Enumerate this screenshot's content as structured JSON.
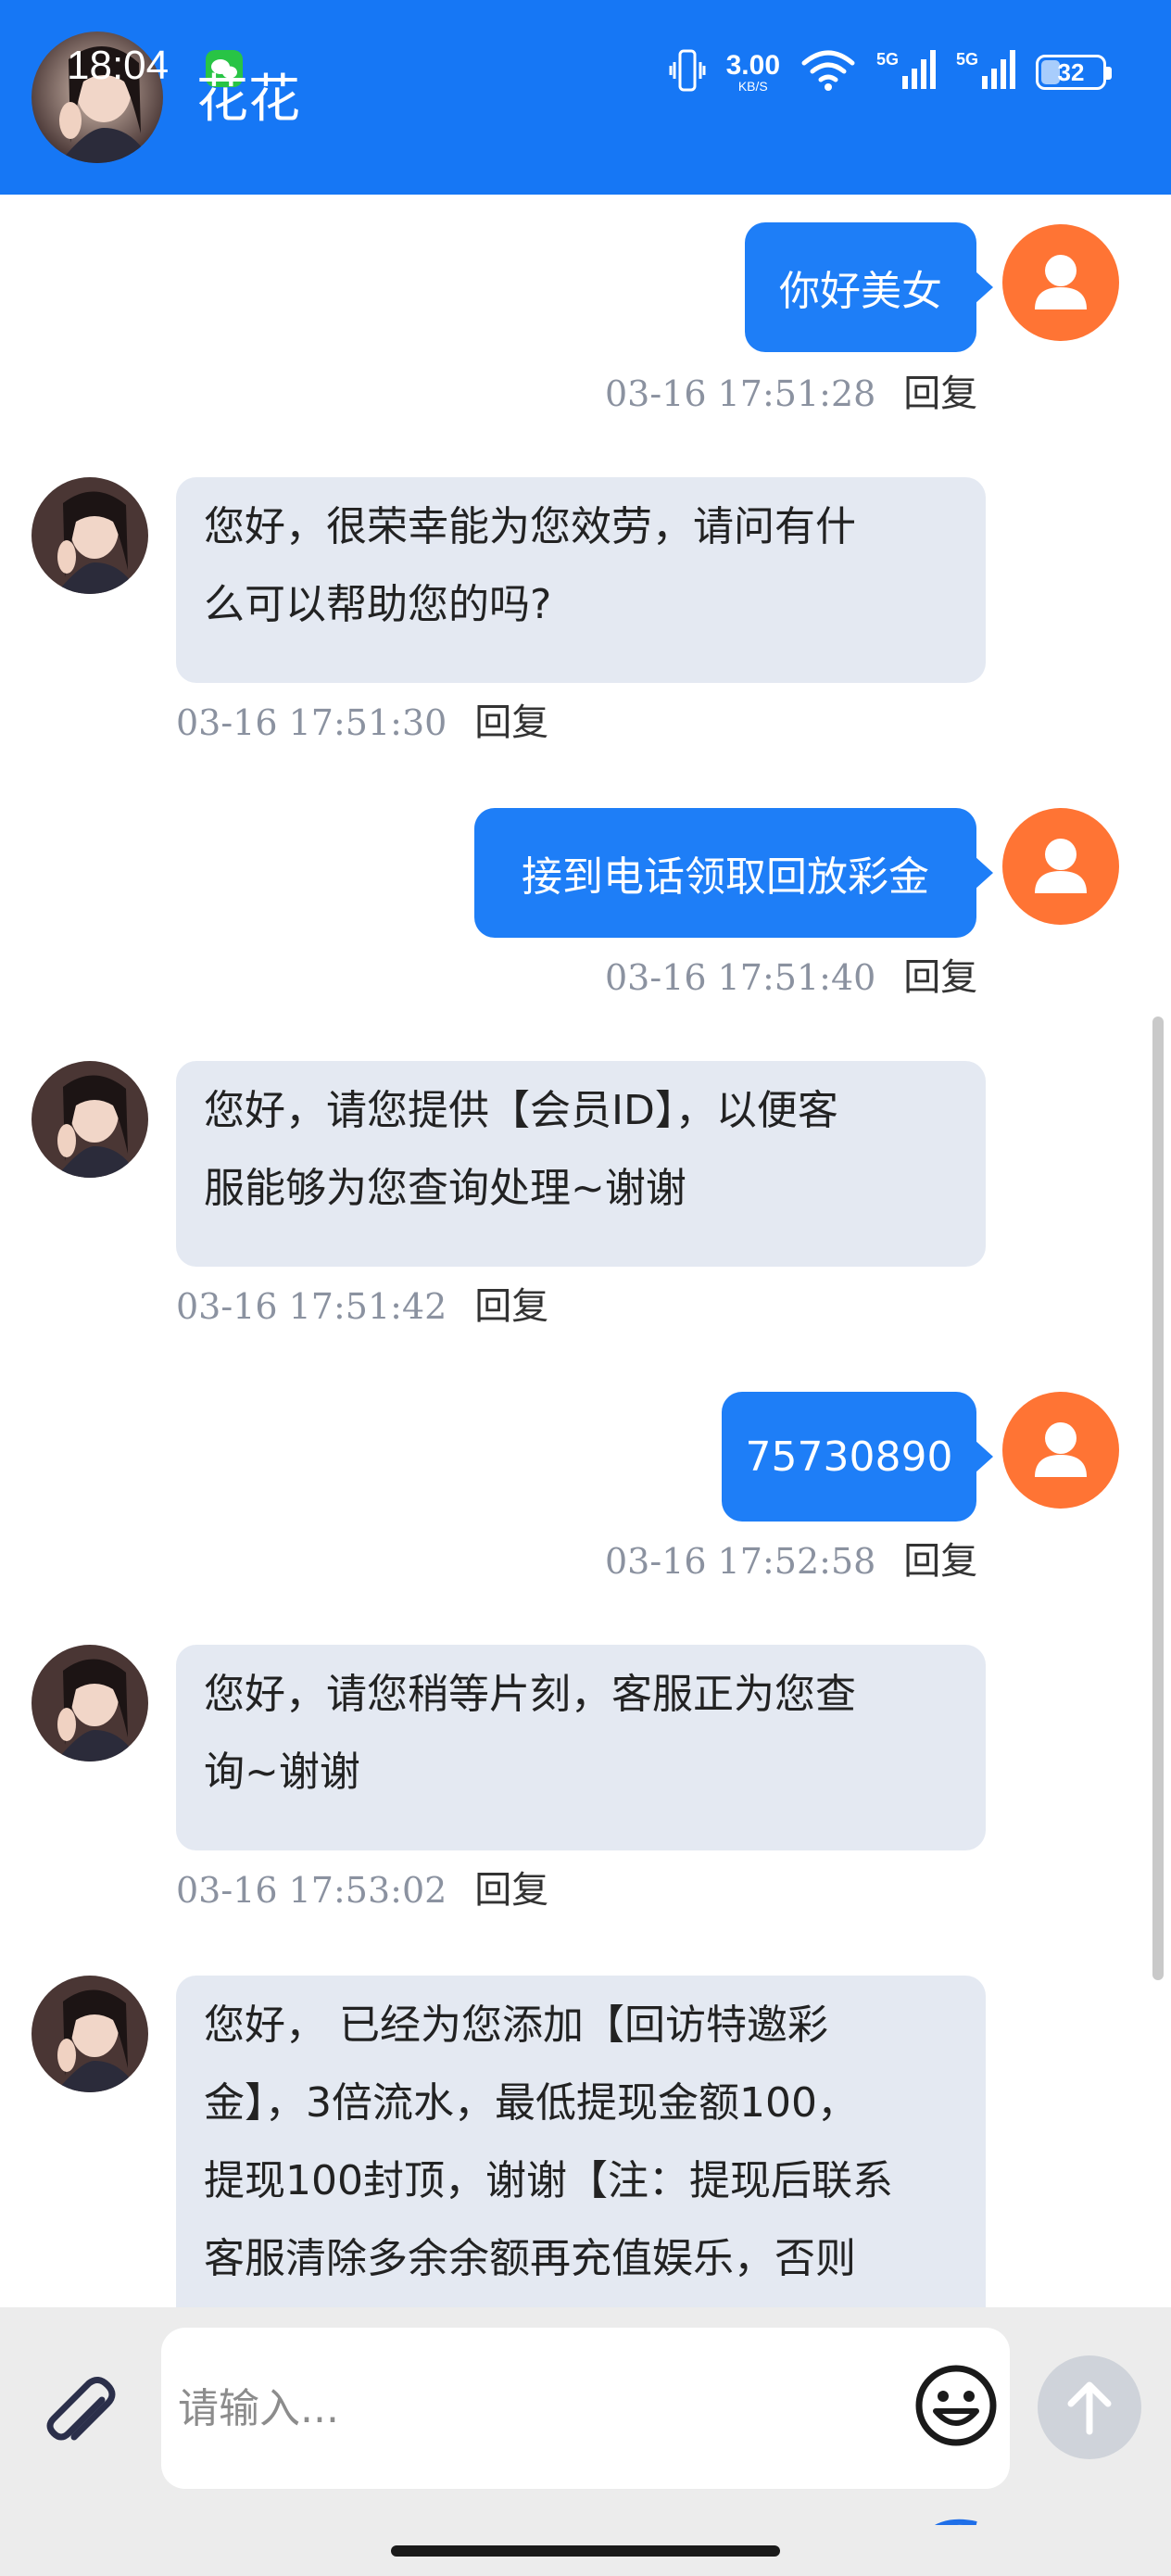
{
  "status_bar": {
    "time": "18:04",
    "net_speed_value": "3.00",
    "net_speed_unit": "KB/S",
    "signal_1": "5G",
    "signal_2": "5G",
    "battery_level": "32",
    "battery_fraction": 0.32
  },
  "header": {
    "contact_name": "花花"
  },
  "messages": [
    {
      "side": "out",
      "lines": [
        "你好美女"
      ],
      "time": "03-16 17:51:28",
      "reply": "回复"
    },
    {
      "side": "in",
      "lines": [
        "您好，很荣幸能为您效劳，请问有什",
        "么可以帮助您的吗?"
      ],
      "time": "03-16 17:51:30",
      "reply": "回复"
    },
    {
      "side": "out",
      "lines": [
        "接到电话领取回放彩金"
      ],
      "time": "03-16 17:51:40",
      "reply": "回复"
    },
    {
      "side": "in",
      "lines": [
        "您好，请您提供【会员ID】，以便客",
        "服能够为您查询处理~谢谢"
      ],
      "time": "03-16 17:51:42",
      "reply": "回复"
    },
    {
      "side": "out",
      "lines": [
        "75730890"
      ],
      "time": "03-16 17:52:58",
      "reply": "回复"
    },
    {
      "side": "in",
      "lines": [
        "您好，请您稍等片刻，客服正为您查",
        "询~谢谢"
      ],
      "time": "03-16 17:53:02",
      "reply": "回复"
    },
    {
      "side": "in",
      "lines": [
        "您好， 已经为您添加【回访特邀彩",
        "金】，3倍流水，最低提现金额100，",
        "提现100封顶，谢谢【注：提现后联系",
        "客服清除多余余额再充值娱乐，否则"
      ],
      "time": "",
      "reply": ""
    }
  ],
  "composer": {
    "placeholder": "请输入..."
  },
  "icons": {
    "attach": "paperclip-icon",
    "emoji": "smiley-icon",
    "send": "arrow-up-icon",
    "user_avatar": "person-icon"
  },
  "colors": {
    "header": "#1677f5",
    "outgoing_bubble": "#1e7ef7",
    "incoming_bubble": "#e4e9f2",
    "user_avatar": "#ff7434"
  }
}
